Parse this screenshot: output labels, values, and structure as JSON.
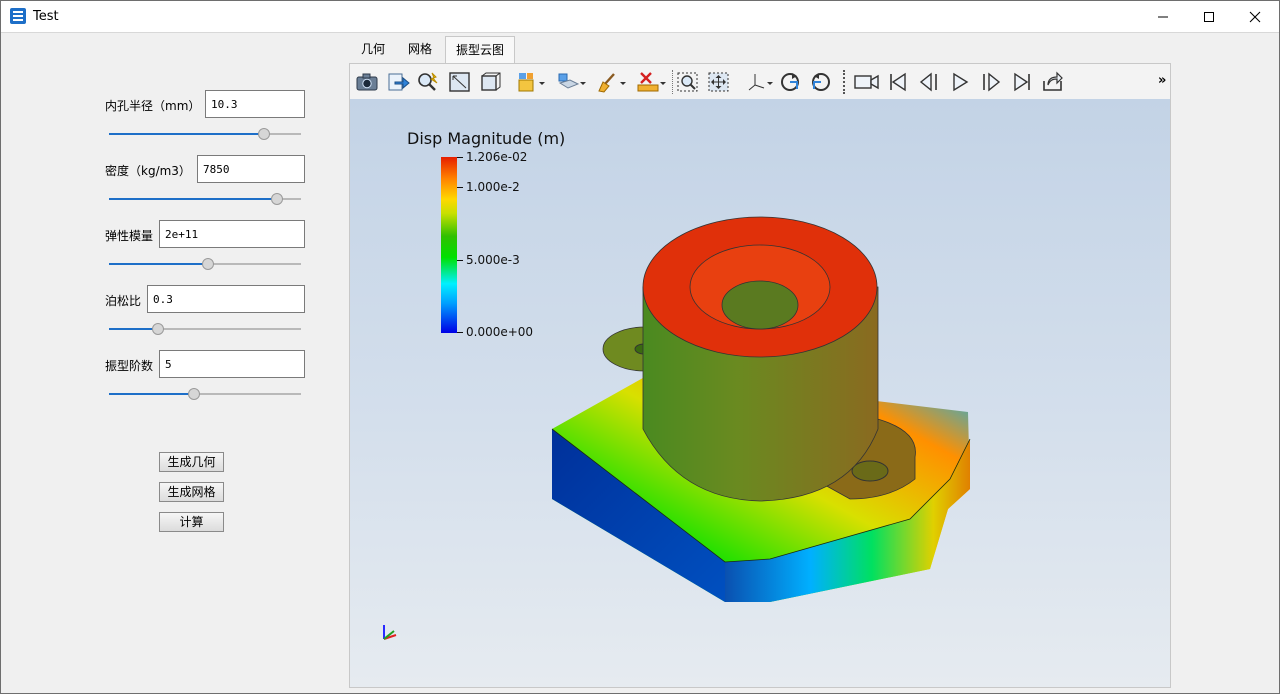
{
  "window": {
    "title": "Test"
  },
  "params": [
    {
      "label": "内孔半径（mm）",
      "value": "10.3",
      "slider": 0.8
    },
    {
      "label": "密度（kg/m3）",
      "value": "7850",
      "slider": 0.87
    },
    {
      "label": "弹性模量",
      "value": "2e+11",
      "slider": 0.51
    },
    {
      "label": "泊松比",
      "value": "0.3",
      "slider": 0.25
    },
    {
      "label": "振型阶数",
      "value": "5",
      "slider": 0.44
    }
  ],
  "buttons": {
    "geometry": "生成几何",
    "mesh": "生成网格",
    "compute": "计算"
  },
  "tabs": [
    {
      "label": "几何"
    },
    {
      "label": "网格"
    },
    {
      "label": "振型云图"
    }
  ],
  "active_tab": 2,
  "toolbar": {
    "icons": [
      "camera-icon",
      "export-icon",
      "reset-zoom-icon",
      "fit-view-icon",
      "box-view-icon",
      "shape-dropdown-icon",
      "clip-dropdown-icon",
      "brush-dropdown-icon",
      "clear-dropdown-icon",
      "zoom-window-icon",
      "pan-icon",
      "axis-dropdown-icon",
      "rotate-cw-icon",
      "rotate-ccw-icon",
      "record-icon",
      "first-frame-icon",
      "prev-frame-icon",
      "play-icon",
      "next-frame-icon",
      "last-frame-icon",
      "share-icon"
    ],
    "more": "»"
  },
  "colorbar": {
    "title": "Disp Magnitude (m)",
    "max_label": "1.206e-02",
    "labels": [
      "1.000e-2",
      "5.000e-3",
      "0.000e+00"
    ],
    "min": 0,
    "max": 0.01206
  },
  "colors": {
    "accent": "#1e6fc8",
    "field_red": "#e61e00",
    "field_blue": "#0000e6"
  }
}
